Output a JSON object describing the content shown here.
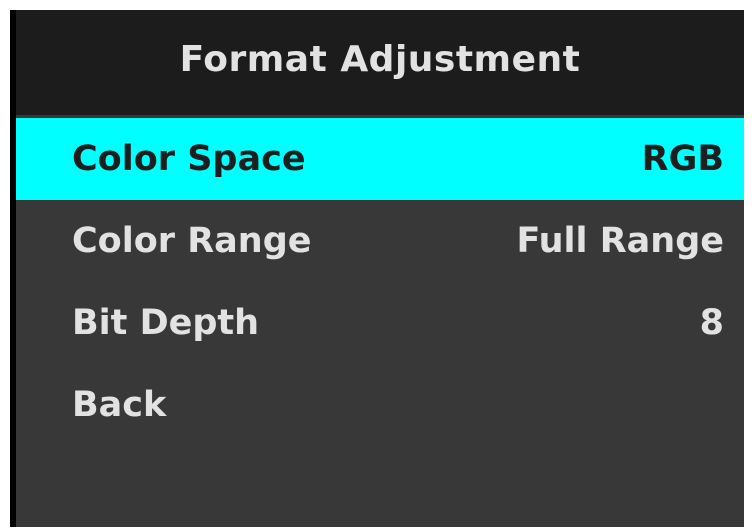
{
  "osd": {
    "title": "Format Adjustment",
    "selected_color": "#00ffff",
    "items": [
      {
        "label": "Color Space",
        "value": "RGB",
        "selected": true
      },
      {
        "label": "Color Range",
        "value": "Full Range",
        "selected": false
      },
      {
        "label": "Bit Depth",
        "value": "8",
        "selected": false
      },
      {
        "label": "Back",
        "value": "",
        "selected": false
      }
    ]
  }
}
